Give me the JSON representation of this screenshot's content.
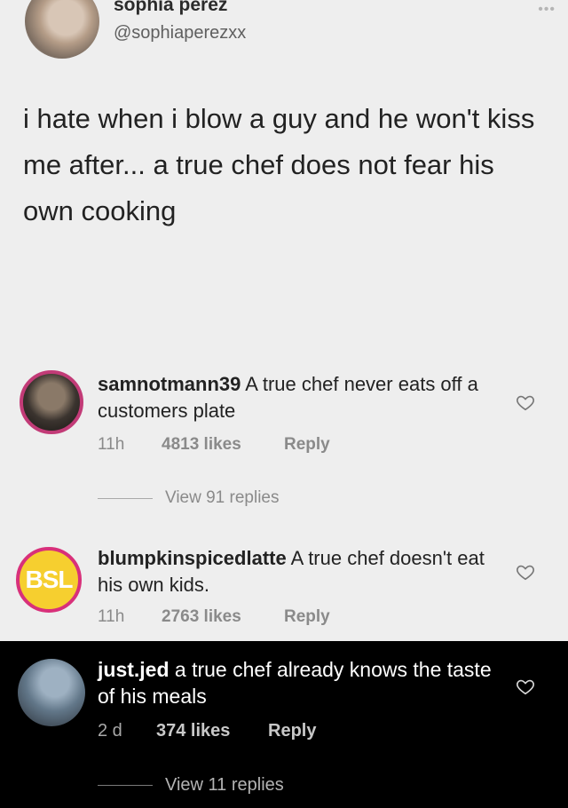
{
  "tweet": {
    "name": "sophia perez",
    "handle": "@sophiaperezxx",
    "text": "i hate when i blow a guy and he won't kiss me after... a true chef does not fear his own cooking"
  },
  "comments": [
    {
      "username": "samnotmann39",
      "text": "A true chef never eats off a customers plate",
      "time": "11h",
      "likes": "4813 likes",
      "reply": "Reply",
      "view_replies": "View 91 replies"
    },
    {
      "username": "blumpkinspicedlatte",
      "avatar_text": "BSL",
      "text": "A true chef doesn't eat his own kids.",
      "time": "11h",
      "likes": "2763 likes",
      "reply": "Reply"
    },
    {
      "username": "just.jed",
      "text": "a true chef already knows the taste of his meals",
      "time": "2 d",
      "likes": "374 likes",
      "reply": "Reply",
      "view_replies": "View 11 replies"
    }
  ],
  "icons": {
    "heart": "heart-icon",
    "more": "more-icon"
  }
}
